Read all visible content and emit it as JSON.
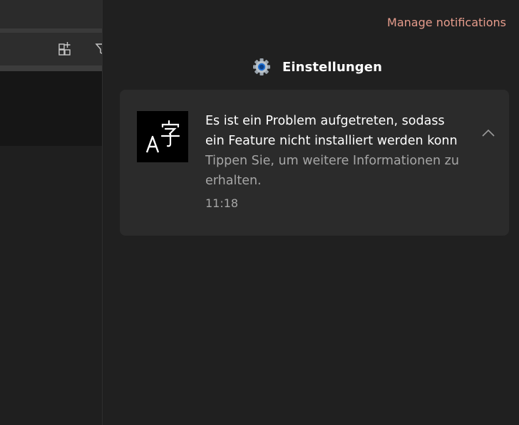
{
  "notification_center": {
    "manage_label": "Manage notifications",
    "group": {
      "app_name": "Einstellungen",
      "icon": "gear-icon"
    },
    "notification": {
      "title_lines": [
        "Es ist ein Problem aufgetreten, sodass",
        "ein Feature nicht installiert werden konn"
      ],
      "body": "Tippen Sie, um weitere Informationen zu erhalten.",
      "time": "11:18",
      "app_icon": "language-icon",
      "expand_icon": "chevron-up-icon"
    }
  },
  "background_app": {
    "toolbar_icons": [
      "add-widget-icon",
      "filter-icon"
    ]
  },
  "colors": {
    "accent_link": "#e69c8c",
    "panel_bg": "#202020",
    "toast_bg": "#2b2b2b",
    "secondary_text": "#a6a6a6"
  }
}
